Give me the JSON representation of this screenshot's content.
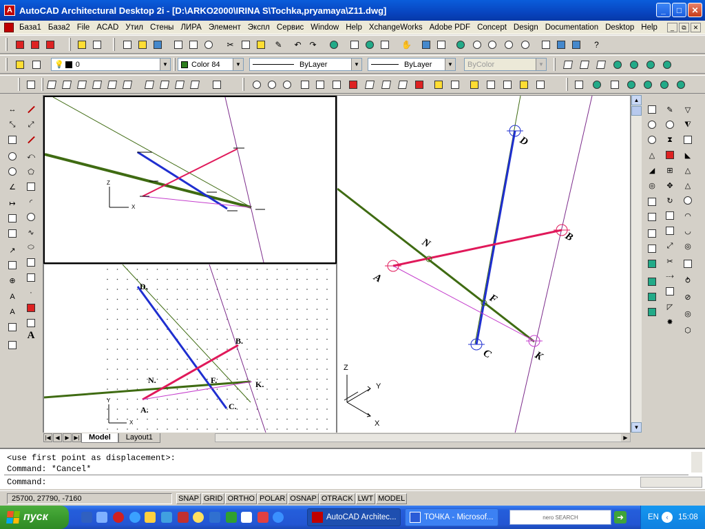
{
  "window": {
    "title": "AutoCAD Architectural Desktop 2i - [D:\\ARKO2000\\IRINA S\\Tochka,pryamaya\\Z11.dwg]",
    "controls": [
      "_",
      "□",
      "✕"
    ]
  },
  "menu": {
    "items": [
      "База1",
      "База2",
      "File",
      "ACAD",
      "Утил",
      "Стены",
      "ЛИРА",
      "Элемент",
      "Экспл",
      "Сервис",
      "Window",
      "Help",
      "XchangeWorks",
      "Adobe PDF",
      "Concept",
      "Design",
      "Documentation",
      "Desktop",
      "Help"
    ],
    "mdi_controls": [
      "_",
      "⧉",
      "✕"
    ]
  },
  "properties": {
    "layer": "0",
    "color": "Color 84",
    "color_hex": "#2e7d1e",
    "linetype": "ByLayer",
    "lineweight": "ByLayer",
    "plotstyle": "ByColor"
  },
  "viewports": {
    "top_left": {
      "ucs_labels": [
        "Z",
        "X"
      ]
    },
    "bottom_left": {
      "point_labels": [
        "D.",
        "B.",
        "N.",
        "F.",
        "K.",
        "A.",
        "C."
      ],
      "ucs_labels": [
        "Y",
        "X"
      ]
    },
    "right": {
      "point_labels": [
        "D",
        "B",
        "N",
        "A",
        "F",
        "C",
        "K"
      ],
      "ucs_labels": [
        "Z",
        "Y",
        "X"
      ]
    }
  },
  "tabs": {
    "nav": [
      "|◀",
      "◀",
      "▶",
      "▶|"
    ],
    "items": [
      "Model",
      "Layout1"
    ]
  },
  "command": {
    "lines": [
      "<use first point as displacement>:",
      "Command: *Cancel*"
    ],
    "prompt": "Command:"
  },
  "status": {
    "coords": "25700, 27790, -7160",
    "toggles": [
      "SNAP",
      "GRID",
      "ORTHO",
      "POLAR",
      "OSNAP",
      "OTRACK",
      "LWT",
      "MODEL"
    ]
  },
  "taskbar": {
    "start_label": "пуск",
    "tasks": [
      "AutoCAD Architec...",
      "ТОЧКА - Microsof..."
    ],
    "search_logo": "nero SEARCH",
    "lang": "EN",
    "clock": "15:08"
  },
  "colors": {
    "line_green": "#3f6b12",
    "line_blue": "#1f2fd0",
    "line_red": "#e0195a",
    "line_magenta": "#c43ccc",
    "line_purple": "#7b2a8a"
  }
}
